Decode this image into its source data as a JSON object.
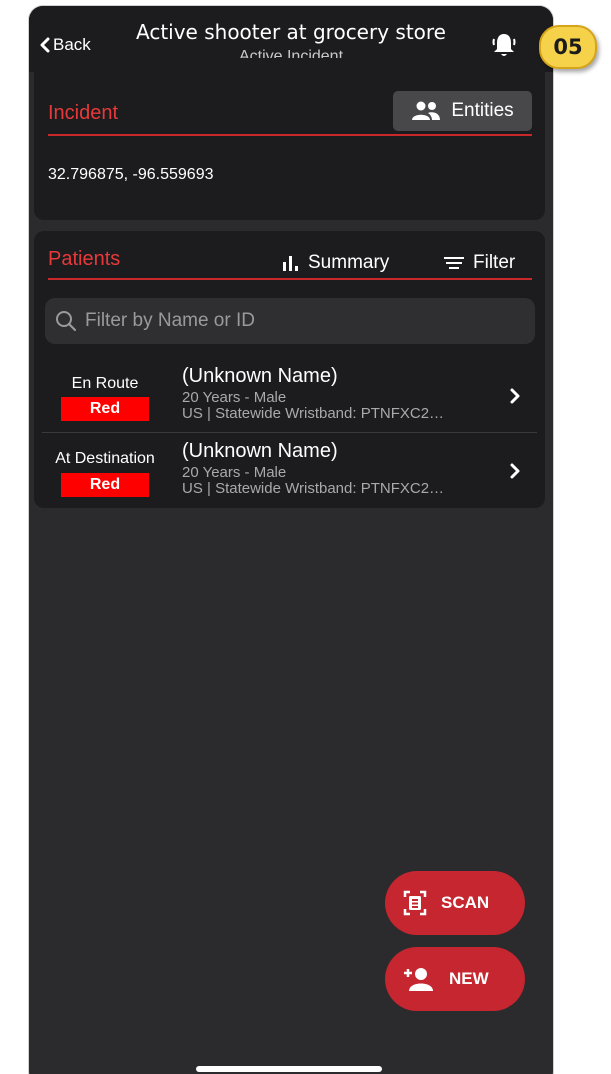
{
  "nav": {
    "back_label": "Back",
    "title": "Active shooter at grocery store",
    "subtitle": "Active Incident"
  },
  "step_badge": "05",
  "incident": {
    "section_title": "Incident",
    "entities_label": "Entities",
    "coordinates": "32.796875, -96.559693"
  },
  "patients": {
    "section_title": "Patients",
    "summary_label": "Summary",
    "filter_label": "Filter",
    "search_placeholder": "Filter by Name or ID",
    "rows": [
      {
        "status": "En Route",
        "triage": "Red",
        "name": "(Unknown Name)",
        "age_sex": "20 Years - Male",
        "id_line": "US | Statewide Wristband: PTNFXC2…"
      },
      {
        "status": "At Destination",
        "triage": "Red",
        "name": "(Unknown Name)",
        "age_sex": "20 Years - Male",
        "id_line": "US | Statewide Wristband: PTNFXC2…"
      }
    ]
  },
  "actions": {
    "scan_label": "SCAN",
    "new_label": "NEW"
  },
  "colors": {
    "accent_red": "#e8393a",
    "triage_red": "#ff0000",
    "fab_red": "#c5262f",
    "badge_yellow": "#f6d24a"
  },
  "icons": [
    "back-chevron-icon",
    "bell-icon",
    "people-icon",
    "bar-chart-icon",
    "filter-lines-icon",
    "search-icon",
    "chevron-right-icon",
    "scan-icon",
    "add-person-icon"
  ]
}
